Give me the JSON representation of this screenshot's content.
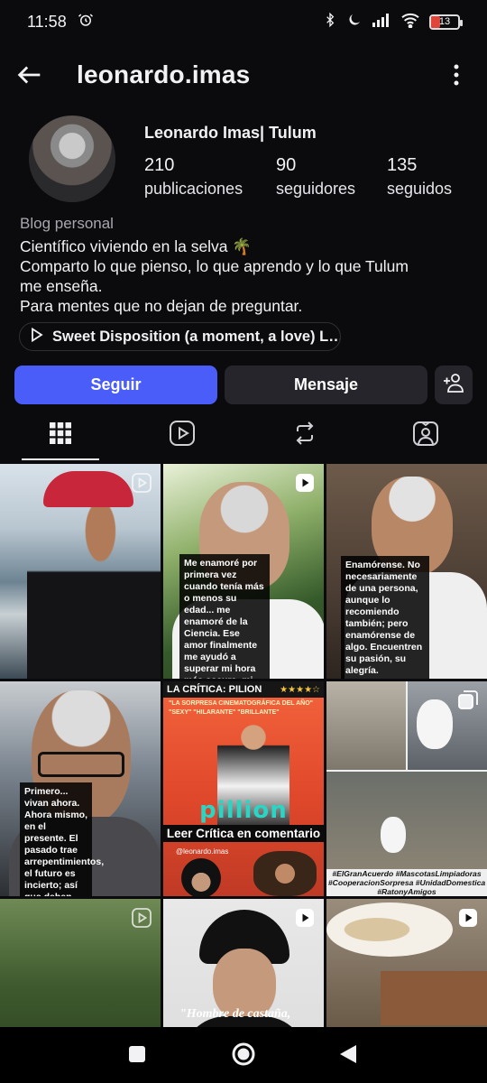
{
  "status_bar": {
    "time": "11:58",
    "battery_level": "13",
    "battery_color": "#e0453a"
  },
  "header": {
    "username": "leonardo.imas"
  },
  "profile": {
    "full_name": "Leonardo Imas| Tulum",
    "stats": [
      {
        "number": "210",
        "label": "publicaciones"
      },
      {
        "number": "90",
        "label": "seguidores"
      },
      {
        "number": "135",
        "label": "seguidos"
      }
    ],
    "category": "Blog personal",
    "bio_lines": [
      "Científico viviendo en la selva 🌴",
      "Comparto lo que pienso, lo que aprendo y lo que Tulum",
      "me enseña.",
      "Para mentes que no dejan de preguntar."
    ],
    "music": "Sweet Disposition (a moment, a love) L…"
  },
  "actions": {
    "follow_label": "Seguir",
    "message_label": "Mensaje",
    "follow_color": "#4a5df9"
  },
  "tabs": [
    "grid-icon",
    "reels-icon",
    "reposts-icon",
    "tagged-icon"
  ],
  "posts": {
    "p2_caption": "Me enamoré por primera vez cuando tenía más o menos su edad... me enamoré de la Ciencia. Ese amor finalmente me ayudó a superar mi hora más oscura, mi día más oscuro, mi año más oscuro.",
    "p3_caption": "Enamórense. No necesariamente de una persona, aunque lo recomiendo también; pero enamórense de algo. Encuentren su pasión, su alegría.",
    "p4_caption": "Primero... vivan ahora. Ahora mismo, en el presente. El pasado trae arrepentimientos, el futuro es incierto; así que deben vivir ahora. El presente es todo lo que tienen. Valórenlo, atesoren cada momento.",
    "p5_header": "LA CRÍTICA: PILION",
    "p5_stars": "★★★★☆",
    "p5_quote": "\"LA SORPRESA CINEMATOGRÁFICA DEL AÑO\" \"SEXY\" \"HILARANTE\" \"BRILLANTE\"",
    "p5_title": "pillion",
    "p5_cta": "Leer Crítica en comentario",
    "p5_handle": "@leonardo.imas",
    "p6_tags": "#ElGranAcuerdo #MascotasLimpiadoras #CooperacionSorpresa #UnidadDomestica #RatonyAmigos",
    "p8_quote": "\"Hombre de castaña,"
  }
}
